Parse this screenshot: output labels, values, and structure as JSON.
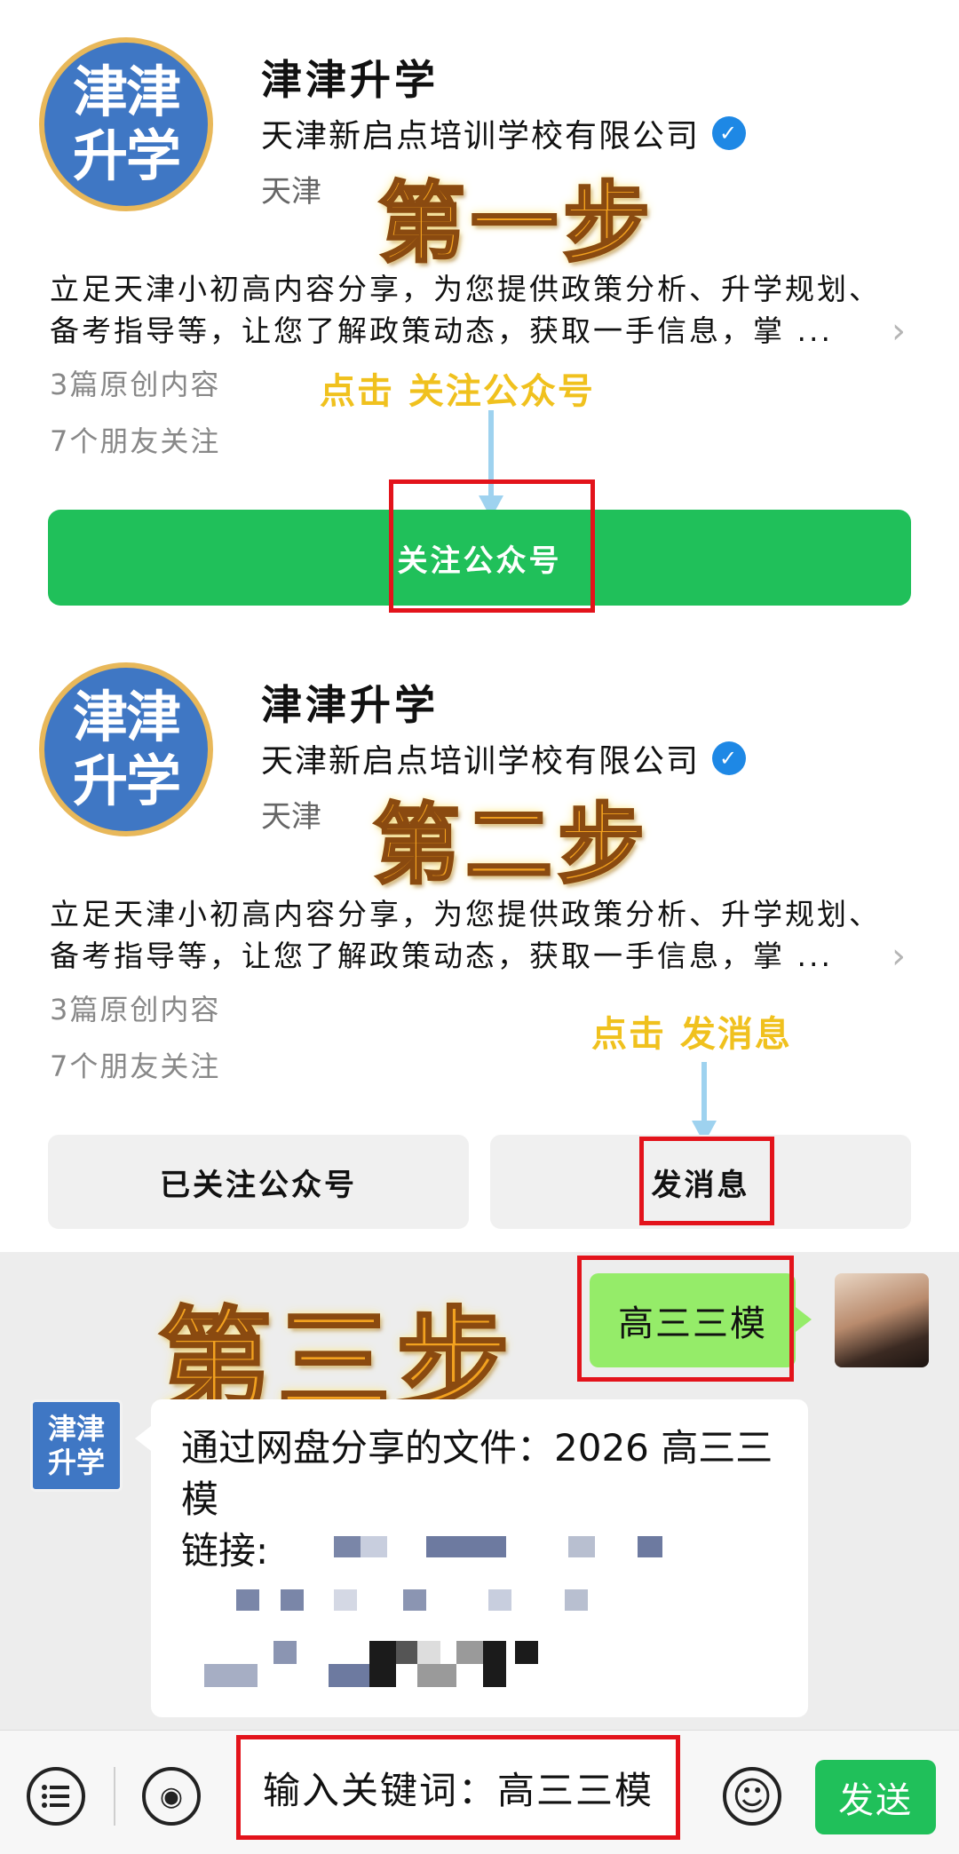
{
  "step1": {
    "avatar_text": [
      "津津",
      "升学"
    ],
    "account_name": "津津升学",
    "organization": "天津新启点培训学校有限公司",
    "verified_mark": "✓",
    "city": "天津",
    "step_label": "第一步",
    "description": "立足天津小初高内容分享，为您提供政策分析、升学规划、备考指导等，让您了解政策动态，获取一手信息，掌 ...",
    "original_count": "3篇原创内容",
    "friends_following": "7个朋友关注",
    "hint": "点击 关注公众号",
    "follow_button": "关注公众号"
  },
  "step2": {
    "avatar_text": [
      "津津",
      "升学"
    ],
    "account_name": "津津升学",
    "organization": "天津新启点培训学校有限公司",
    "verified_mark": "✓",
    "city": "天津",
    "step_label": "第二步",
    "description": "立足天津小初高内容分享，为您提供政策分析、升学规划、备考指导等，让您了解政策动态，获取一手信息，掌 ...",
    "original_count": "3篇原创内容",
    "friends_following": "7个朋友关注",
    "hint": "点击 发消息",
    "followed_button": "已关注公众号",
    "message_button": "发消息"
  },
  "step3": {
    "step_label": "第三步",
    "sent_message": "高三三模",
    "bot_avatar_text": [
      "津津",
      "升学"
    ],
    "reply_line1": "通过网盘分享的文件：2026 高三三模",
    "reply_line2": "链接:"
  },
  "input_bar": {
    "input_text": "输入关键词：高三三模",
    "send_button": "发送",
    "voice_icon_glyph": "◉",
    "emoji_icon_glyph": "☺"
  },
  "colors": {
    "wechat_green": "#20c05a",
    "highlight_red": "#e3131b",
    "step_orange": "#f3a21f",
    "hint_yellow": "#f0c11e",
    "arrow_blue": "#9ed2ef",
    "avatar_blue": "#3f77c4"
  }
}
